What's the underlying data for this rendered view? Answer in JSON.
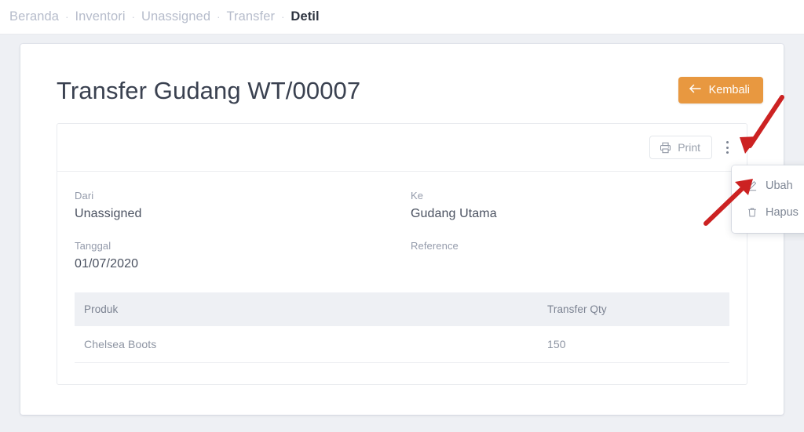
{
  "breadcrumb": {
    "separator": "·",
    "items": [
      {
        "label": "Beranda",
        "current": false
      },
      {
        "label": "Inventori",
        "current": false
      },
      {
        "label": "Unassigned",
        "current": false
      },
      {
        "label": "Transfer",
        "current": false
      },
      {
        "label": "Detil",
        "current": true
      }
    ]
  },
  "header": {
    "title": "Transfer Gudang WT/00007",
    "back_button": {
      "label": "Kembali",
      "icon": "arrow-left-icon",
      "color": "#e89840"
    }
  },
  "toolbar": {
    "print_label": "Print",
    "print_icon": "printer-icon",
    "kebab_icon": "more-vertical-icon"
  },
  "dropdown": {
    "visible": true,
    "items": [
      {
        "label": "Ubah",
        "icon": "pencil-icon"
      },
      {
        "label": "Hapus",
        "icon": "trash-icon"
      }
    ]
  },
  "details": {
    "left": [
      {
        "label": "Dari",
        "value": "Unassigned"
      },
      {
        "label": "Tanggal",
        "value": "01/07/2020"
      }
    ],
    "right": [
      {
        "label": "Ke",
        "value": "Gudang Utama"
      },
      {
        "label": "Reference",
        "value": ""
      }
    ]
  },
  "table": {
    "columns": [
      "Produk",
      "Transfer Qty"
    ],
    "rows": [
      {
        "produk": "Chelsea Boots",
        "qty": "150"
      }
    ]
  },
  "annotations": {
    "color": "#cc2222",
    "arrows": [
      {
        "name": "arrow-to-kebab-menu",
        "points_to": "more-vertical-icon"
      },
      {
        "name": "arrow-to-ubah-item",
        "points_to": "Ubah"
      }
    ]
  }
}
